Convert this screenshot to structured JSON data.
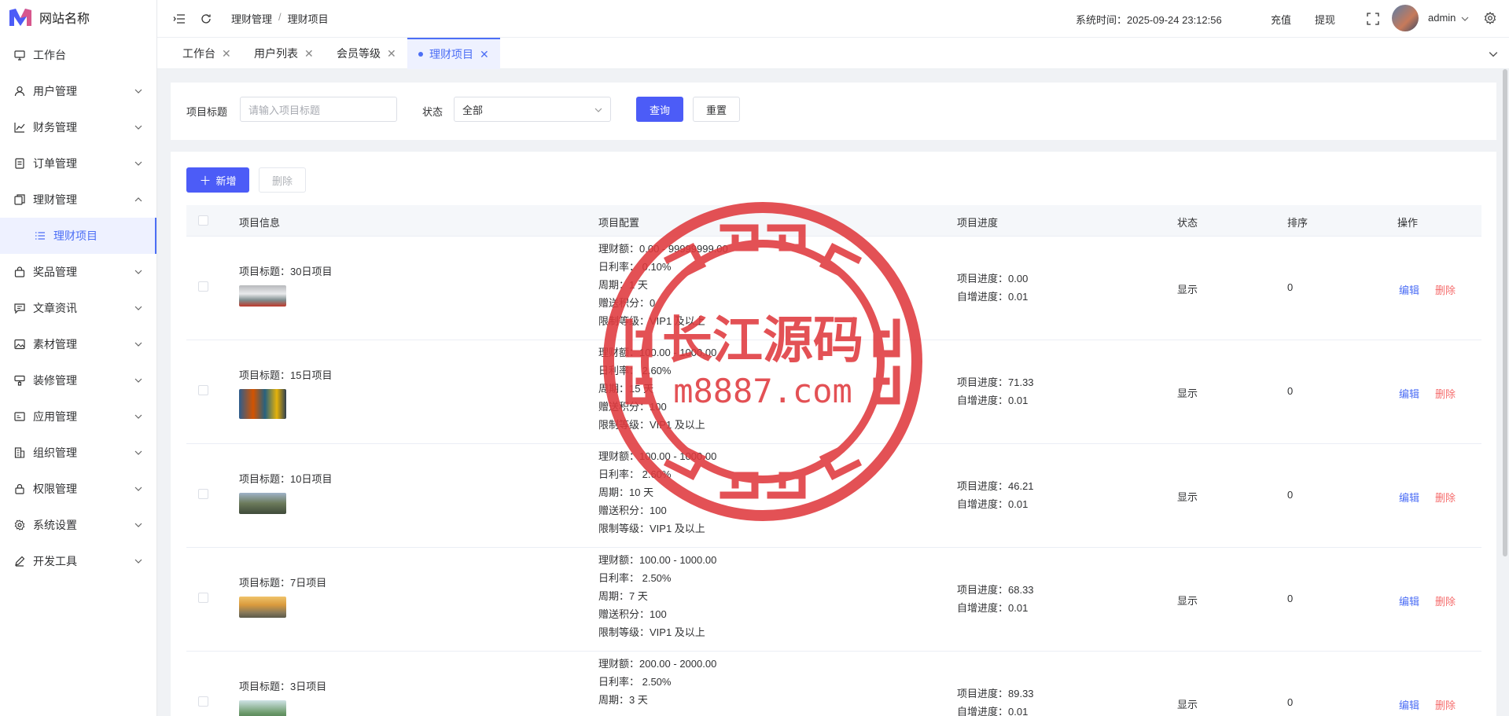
{
  "app": {
    "site_name": "网站名称"
  },
  "sidebar": {
    "items": [
      {
        "label": "工作台",
        "icon": "monitor-icon",
        "has_children": false
      },
      {
        "label": "用户管理",
        "icon": "user-icon",
        "has_children": true
      },
      {
        "label": "财务管理",
        "icon": "chart-icon",
        "has_children": true
      },
      {
        "label": "订单管理",
        "icon": "order-icon",
        "has_children": true
      },
      {
        "label": "理财管理",
        "icon": "wallet-icon",
        "has_children": true,
        "expanded": true
      },
      {
        "label": "奖品管理",
        "icon": "bag-icon",
        "has_children": true
      },
      {
        "label": "文章资讯",
        "icon": "message-icon",
        "has_children": true
      },
      {
        "label": "素材管理",
        "icon": "image-icon",
        "has_children": true
      },
      {
        "label": "装修管理",
        "icon": "paint-icon",
        "has_children": true
      },
      {
        "label": "应用管理",
        "icon": "app-icon",
        "has_children": true
      },
      {
        "label": "组织管理",
        "icon": "building-icon",
        "has_children": true
      },
      {
        "label": "权限管理",
        "icon": "lock-icon",
        "has_children": true
      },
      {
        "label": "系统设置",
        "icon": "gear-icon",
        "has_children": true
      },
      {
        "label": "开发工具",
        "icon": "pen-icon",
        "has_children": true
      }
    ],
    "sub_item": {
      "label": "理财项目",
      "icon": "list-icon"
    }
  },
  "topbar": {
    "breadcrumb": [
      "理财管理",
      "理财项目"
    ],
    "breadcrumb_sep": "/",
    "system_time": "系统时间：2025-09-24 23:12:56",
    "recharge": "充值",
    "withdraw": "提现",
    "user": "admin"
  },
  "tabs": [
    {
      "label": "工作台",
      "active": false
    },
    {
      "label": "用户列表",
      "active": false
    },
    {
      "label": "会员等级",
      "active": false
    },
    {
      "label": "理财项目",
      "active": true
    }
  ],
  "filter": {
    "title_label": "项目标题",
    "title_placeholder": "请输入项目标题",
    "status_label": "状态",
    "status_value": "全部",
    "query_button": "查询",
    "reset_button": "重置"
  },
  "toolbar": {
    "add_button": "新增",
    "delete_button": "删除"
  },
  "table": {
    "headers": [
      "项目信息",
      "项目配置",
      "项目进度",
      "状态",
      "排序",
      "操作"
    ],
    "edit_label": "编辑",
    "delete_label": "删除",
    "rows": [
      {
        "title": "项目标题：30日项目",
        "amount": "理财额：0.00 - 99999999.00",
        "rate": "日利率：  0.10%",
        "period": "周期：1 天",
        "points": "赠送积分：0",
        "level": "限制等级：VIP1 及以上",
        "progress": "项目进度：0.00",
        "auto": "自增进度：0.01",
        "status": "显示",
        "sort": "0"
      },
      {
        "title": "项目标题：15日项目",
        "amount": "理财额：100.00 - 1000.00",
        "rate": "日利率：  2.60%",
        "period": "周期：15 天",
        "points": "赠送积分：100",
        "level": "限制等级：VIP1 及以上",
        "progress": "项目进度：71.33",
        "auto": "自增进度：0.01",
        "status": "显示",
        "sort": "0"
      },
      {
        "title": "项目标题：10日项目",
        "amount": "理财额：100.00 - 1000.00",
        "rate": "日利率：  2.60%",
        "period": "周期：10 天",
        "points": "赠送积分：100",
        "level": "限制等级：VIP1 及以上",
        "progress": "项目进度：46.21",
        "auto": "自增进度：0.01",
        "status": "显示",
        "sort": "0"
      },
      {
        "title": "项目标题：7日项目",
        "amount": "理财额：100.00 - 1000.00",
        "rate": "日利率：  2.50%",
        "period": "周期：7 天",
        "points": "赠送积分：100",
        "level": "限制等级：VIP1 及以上",
        "progress": "项目进度：68.33",
        "auto": "自增进度：0.01",
        "status": "显示",
        "sort": "0"
      },
      {
        "title": "项目标题：3日项目",
        "amount": "理财额：200.00 - 2000.00",
        "rate": "日利率：  2.50%",
        "period": "周期：3 天",
        "points": "",
        "level": "",
        "progress": "项目进度：89.33",
        "auto": "自增进度：0.01",
        "status": "显示",
        "sort": "0"
      }
    ]
  },
  "watermark": {
    "line1": "长江源码",
    "line2": "m8887.com",
    "color": "#e03a3e"
  },
  "colors": {
    "primary": "#4c5cf7",
    "danger": "#f56c6c",
    "link": "#4c6ef5"
  }
}
